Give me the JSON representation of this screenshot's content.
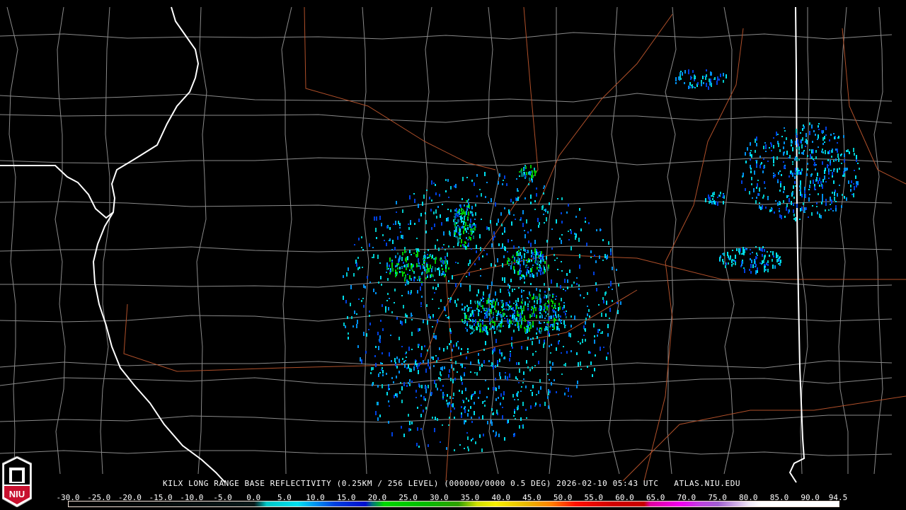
{
  "product": {
    "title": "KILX LONG RANGE BASE REFLECTIVITY (0.25KM / 256 LEVEL) (000000/0000 0.5 DEG) 2026-02-10 05:43 UTC   ATLAS.NIU.EDU",
    "station": "KILX",
    "valid_time": "2026-02-10 05:43 UTC",
    "website": "ATLAS.NIU.EDU"
  },
  "logo": {
    "text": "NIU",
    "color": "#c8102e"
  },
  "colorbar": {
    "labels": [
      "-30.0",
      "-25.0",
      "-20.0",
      "-15.0",
      "-10.0",
      "-5.0",
      "0.0",
      "5.0",
      "10.0",
      "15.0",
      "20.0",
      "25.0",
      "30.0",
      "35.0",
      "40.0",
      "45.0",
      "50.0",
      "55.0",
      "60.0",
      "65.0",
      "70.0",
      "75.0",
      "80.0",
      "85.0",
      "90.0",
      "94.5"
    ],
    "stops": [
      {
        "dbz": -30,
        "color": "#000000"
      },
      {
        "dbz": 0,
        "color": "#0a1a1a"
      },
      {
        "dbz": 1,
        "color": "#007070"
      },
      {
        "dbz": 2,
        "color": "#00c8c8"
      },
      {
        "dbz": 7,
        "color": "#00e0f0"
      },
      {
        "dbz": 10,
        "color": "#0090f0"
      },
      {
        "dbz": 13,
        "color": "#0040e0"
      },
      {
        "dbz": 18,
        "color": "#0010d0"
      },
      {
        "dbz": 19,
        "color": "#007080"
      },
      {
        "dbz": 21,
        "color": "#00d800"
      },
      {
        "dbz": 27,
        "color": "#00c000"
      },
      {
        "dbz": 33,
        "color": "#30a000"
      },
      {
        "dbz": 36,
        "color": "#d0e000"
      },
      {
        "dbz": 39,
        "color": "#f8f000"
      },
      {
        "dbz": 44,
        "color": "#e8b800"
      },
      {
        "dbz": 48,
        "color": "#ff8000"
      },
      {
        "dbz": 52,
        "color": "#ff1000"
      },
      {
        "dbz": 58,
        "color": "#d00000"
      },
      {
        "dbz": 63,
        "color": "#c80000"
      },
      {
        "dbz": 64,
        "color": "#e000a0"
      },
      {
        "dbz": 69,
        "color": "#f000f0"
      },
      {
        "dbz": 72,
        "color": "#c040e0"
      },
      {
        "dbz": 75,
        "color": "#a060d0"
      },
      {
        "dbz": 78,
        "color": "#d0b0e8"
      },
      {
        "dbz": 80,
        "color": "#f0e8f8"
      },
      {
        "dbz": 82,
        "color": "#ffffff"
      },
      {
        "dbz": 94.5,
        "color": "#ffffff"
      }
    ]
  },
  "colors": {
    "state_border": "#ffffff",
    "county_border": "#8a8a8a",
    "highway": "#b0502a"
  }
}
